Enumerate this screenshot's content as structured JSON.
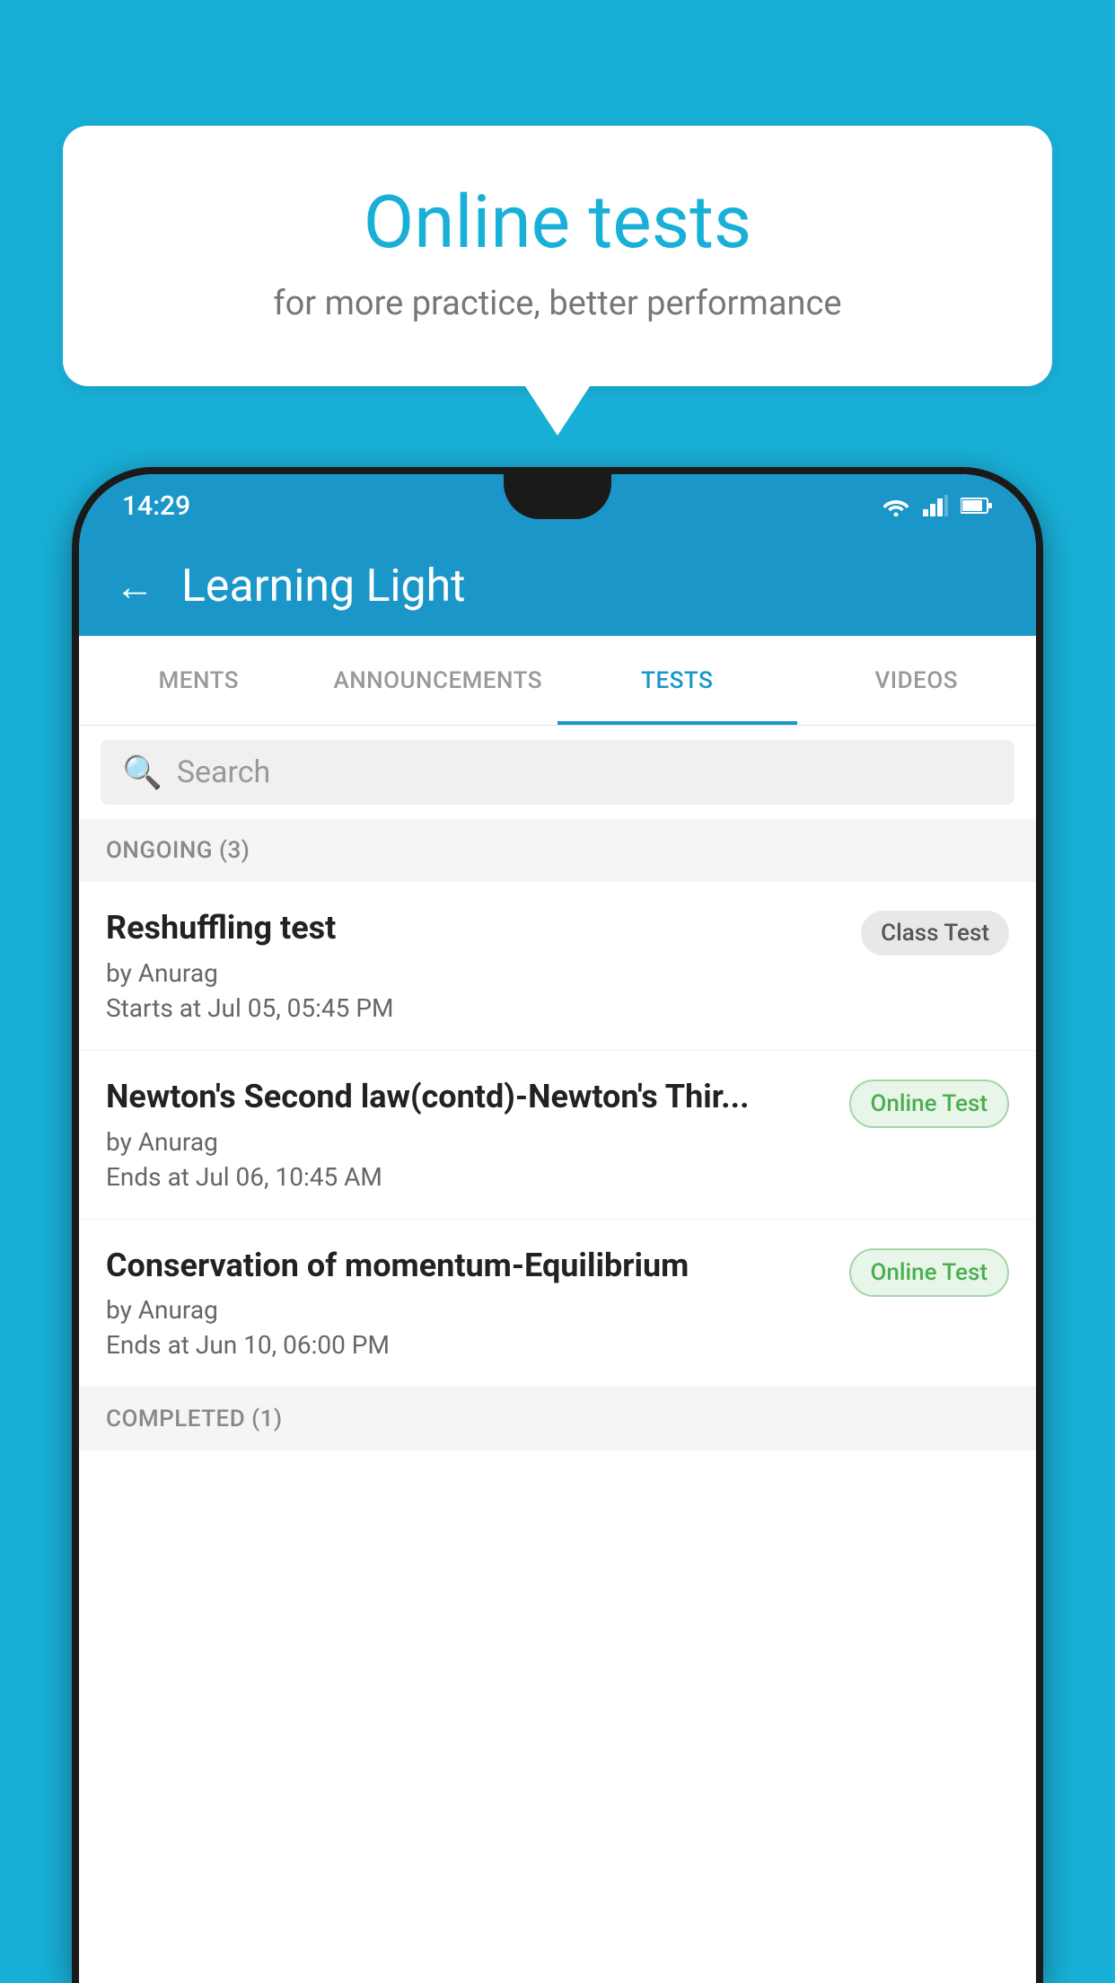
{
  "background_color": "#19b0d8",
  "speech_bubble": {
    "title": "Online tests",
    "subtitle": "for more practice, better performance"
  },
  "status_bar": {
    "time": "14:29",
    "icons": [
      "wifi",
      "signal",
      "battery"
    ]
  },
  "app_bar": {
    "back_label": "←",
    "title": "Learning Light"
  },
  "tabs": [
    {
      "label": "MENTS",
      "active": false
    },
    {
      "label": "ANNOUNCEMENTS",
      "active": false
    },
    {
      "label": "TESTS",
      "active": true
    },
    {
      "label": "VIDEOS",
      "active": false
    }
  ],
  "search": {
    "placeholder": "Search"
  },
  "ongoing_section": {
    "label": "ONGOING (3)"
  },
  "test_items": [
    {
      "title": "Reshuffling test",
      "author": "by Anurag",
      "date": "Starts at  Jul 05, 05:45 PM",
      "badge": "Class Test",
      "badge_type": "class"
    },
    {
      "title": "Newton's Second law(contd)-Newton's Thir...",
      "author": "by Anurag",
      "date": "Ends at  Jul 06, 10:45 AM",
      "badge": "Online Test",
      "badge_type": "online"
    },
    {
      "title": "Conservation of momentum-Equilibrium",
      "author": "by Anurag",
      "date": "Ends at  Jun 10, 06:00 PM",
      "badge": "Online Test",
      "badge_type": "online"
    }
  ],
  "completed_section": {
    "label": "COMPLETED (1)"
  }
}
